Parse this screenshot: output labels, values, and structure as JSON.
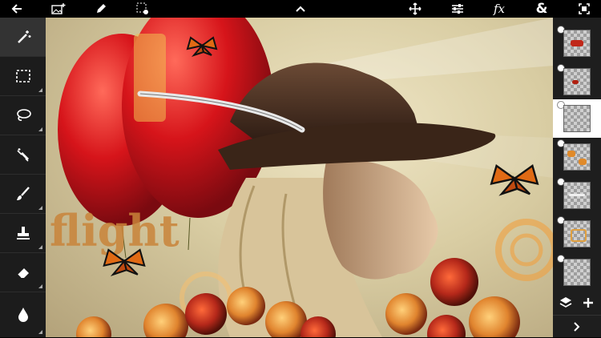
{
  "toolbar": {
    "buttons": [
      {
        "id": "back",
        "icon": "back-arrow-icon"
      },
      {
        "id": "add-image",
        "icon": "add-image-icon"
      },
      {
        "id": "brush",
        "icon": "pencil-icon"
      },
      {
        "id": "selection",
        "icon": "selection-settings-icon"
      },
      {
        "id": "collapse",
        "icon": "chevron-up-icon"
      },
      {
        "id": "move",
        "icon": "move-icon"
      },
      {
        "id": "adjust",
        "icon": "sliders-icon"
      },
      {
        "id": "fx",
        "icon": "fx-icon",
        "label": "fx"
      },
      {
        "id": "blend",
        "icon": "ampersand-icon",
        "label": "&"
      },
      {
        "id": "fullscreen",
        "icon": "fullscreen-icon"
      }
    ]
  },
  "tools": [
    {
      "name": "magic-wand",
      "icon": "magic-wand-icon",
      "active": true
    },
    {
      "name": "rectangle-select",
      "icon": "marquee-icon"
    },
    {
      "name": "lasso",
      "icon": "lasso-icon"
    },
    {
      "name": "wand-select",
      "icon": "wand-select-icon"
    },
    {
      "name": "brush",
      "icon": "brush-icon"
    },
    {
      "name": "stamp",
      "icon": "clone-stamp-icon"
    },
    {
      "name": "eraser",
      "icon": "eraser-icon"
    },
    {
      "name": "blur",
      "icon": "drop-icon"
    }
  ],
  "artwork": {
    "text": "flight"
  },
  "layers": [
    {
      "name": "layer-1"
    },
    {
      "name": "layer-2"
    },
    {
      "name": "layer-3",
      "selected": true
    },
    {
      "name": "layer-4"
    },
    {
      "name": "layer-5"
    },
    {
      "name": "layer-6"
    },
    {
      "name": "layer-7"
    }
  ],
  "layer_actions": {
    "layers_icon": "layers-icon",
    "add_icon": "plus-icon",
    "expand_icon": "chevron-right-icon"
  },
  "colors": {
    "toolbar_bg": "#000000",
    "sidebar_bg": "#1c1c1c",
    "selected_layer": "#ffffff"
  }
}
